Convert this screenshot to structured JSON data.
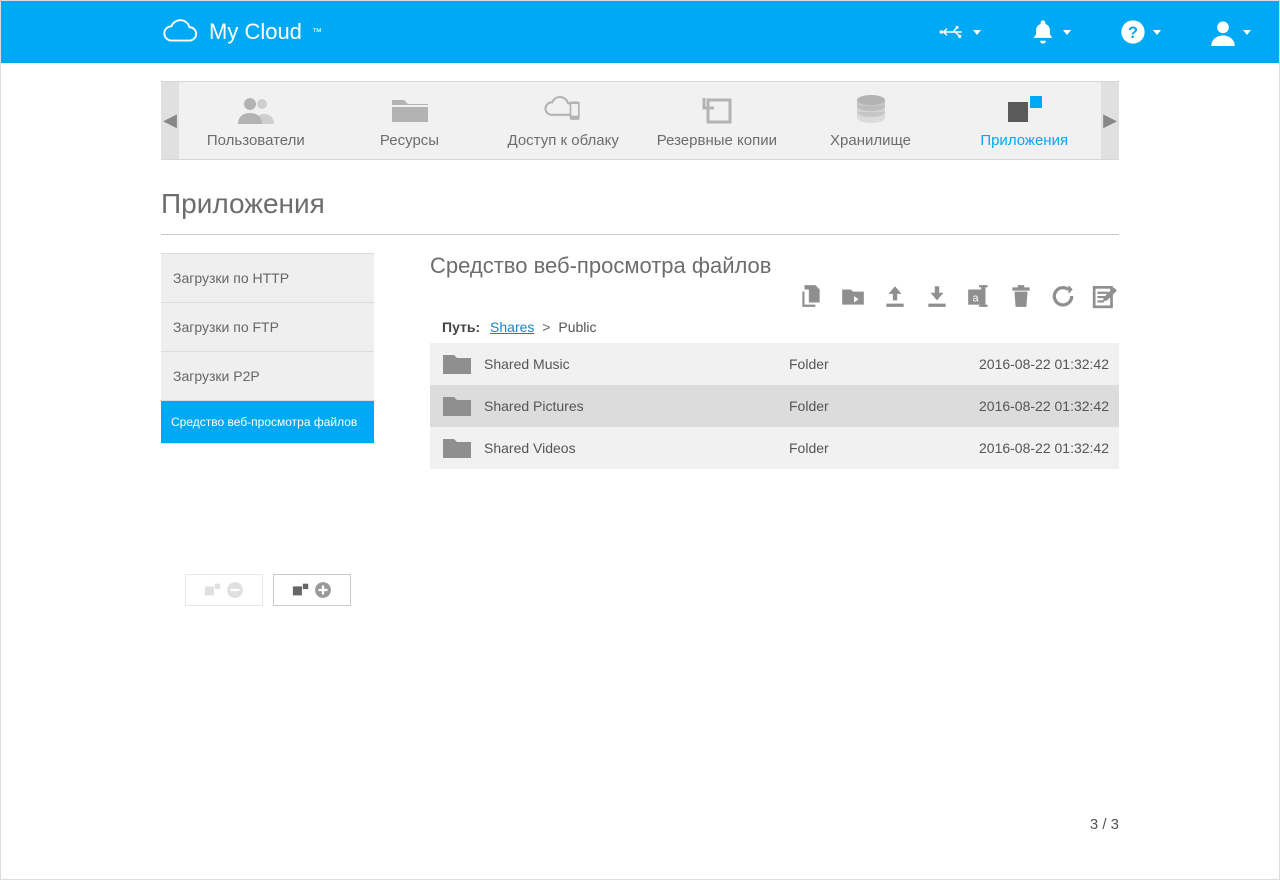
{
  "brand": "My Cloud",
  "nav_tabs": {
    "users": "Пользователи",
    "resources": "Ресурсы",
    "cloud_access": "Доступ к облаку",
    "backup": "Резервные копии",
    "storage": "Хранилище",
    "apps": "Приложения"
  },
  "page_title": "Приложения",
  "sidebar": {
    "items": [
      {
        "label": "Загрузки по HTTP"
      },
      {
        "label": "Загрузки по FTP"
      },
      {
        "label": "Загрузки P2P"
      },
      {
        "label": "Средство веб-просмотра файлов"
      }
    ]
  },
  "main": {
    "heading": "Средство веб-просмотра файлов",
    "path_label": "Путь:",
    "path_root": "Shares",
    "path_sep": ">",
    "path_current": "Public",
    "files": [
      {
        "name": "Shared Music",
        "type": "Folder",
        "date": "2016-08-22 01:32:42"
      },
      {
        "name": "Shared Pictures",
        "type": "Folder",
        "date": "2016-08-22 01:32:42"
      },
      {
        "name": "Shared Videos",
        "type": "Folder",
        "date": "2016-08-22 01:32:42"
      }
    ],
    "count": "3 / 3"
  }
}
